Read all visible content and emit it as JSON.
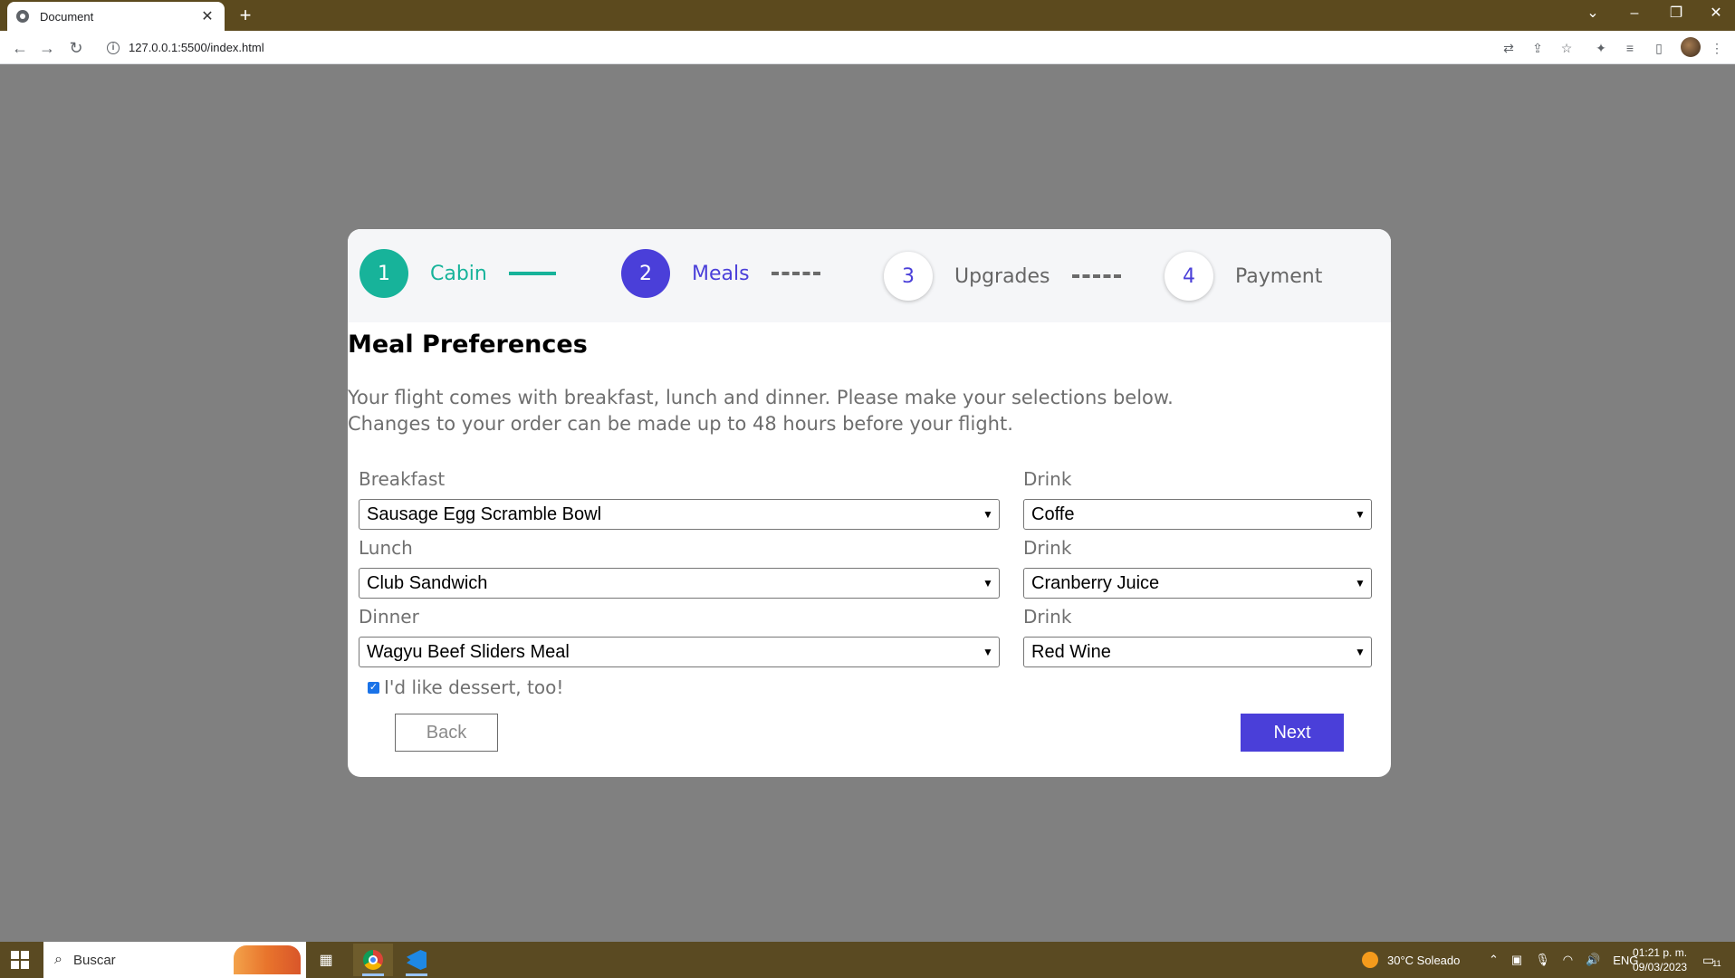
{
  "browser": {
    "tab_title": "Document",
    "tab_close": "✕",
    "new_tab": "+",
    "url": "127.0.0.1:5500/index.html",
    "window_controls": {
      "collapse": "⌄",
      "minimize": "–",
      "restore": "❐",
      "close": "✕"
    }
  },
  "stepper": {
    "steps": [
      {
        "number": "1",
        "label": "Cabin",
        "state": "completed",
        "color": "#17b39a"
      },
      {
        "number": "2",
        "label": "Meals",
        "state": "current",
        "color": "#4a3fd9"
      },
      {
        "number": "3",
        "label": "Upgrades",
        "state": "upcoming"
      },
      {
        "number": "4",
        "label": "Payment",
        "state": "upcoming"
      }
    ]
  },
  "form": {
    "title": "Meal Preferences",
    "description_line1": "Your flight comes with breakfast, lunch and dinner. Please make your selections below.",
    "description_line2": "Changes to your order can be made up to 48 hours before your flight.",
    "breakfast": {
      "label": "Breakfast",
      "value": "Sausage Egg Scramble Bowl"
    },
    "breakfast_drink": {
      "label": "Drink",
      "value": "Coffe"
    },
    "lunch": {
      "label": "Lunch",
      "value": "Club Sandwich"
    },
    "lunch_drink": {
      "label": "Drink",
      "value": "Cranberry Juice"
    },
    "dinner": {
      "label": "Dinner",
      "value": "Wagyu Beef Sliders Meal"
    },
    "dinner_drink": {
      "label": "Drink",
      "value": "Red Wine"
    },
    "dessert": {
      "label": "I'd like dessert, too!",
      "checked": true
    },
    "back_label": "Back",
    "next_label": "Next"
  },
  "taskbar": {
    "search_text": "Buscar",
    "weather": "30°C  Soleado",
    "language": "ENG",
    "time": "01:21 p. m.",
    "date": "09/03/2023",
    "notification_count": "11"
  },
  "colors": {
    "accent": "#4a3fd9",
    "completed": "#17b39a",
    "backdrop": "#808080"
  }
}
